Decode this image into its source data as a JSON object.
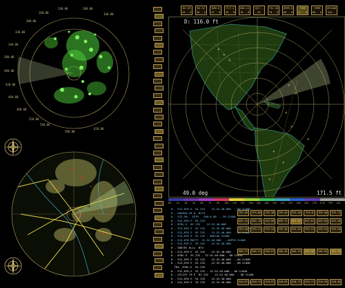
{
  "map_panel": {
    "range_readout": "D: 116.0 ft",
    "bearing_readout": "49.0 deg",
    "distance_readout": "171.5 ft"
  },
  "header_buttons": [
    {
      "top": "NJ-69",
      "bottom": "20 - 5"
    },
    {
      "top": "NJ-32",
      "bottom": "56 - 6"
    },
    {
      "top": "BGN-8",
      "bottom": "15 - 8"
    },
    {
      "top": "FLT-2",
      "bottom": "45 - 8"
    },
    {
      "top": "ENG-11",
      "bottom": "78 - 8"
    },
    {
      "top": "OCC - 81",
      "bottom": "78 - 8"
    },
    {
      "top": "TIL-38",
      "bottom": "78 - 8"
    },
    {
      "top": "OPER-8",
      "bottom": "68 - 8"
    },
    {
      "top": "TERM",
      "bottom": "47 - 8"
    },
    {
      "top": "TERM",
      "bottom": "66 - 8"
    },
    {
      "top": "UPLOAD",
      "bottom": "943 - 8"
    }
  ],
  "color_scale": [
    "NO",
    "15",
    "30",
    "45",
    "60",
    "75",
    "90",
    "105",
    "120",
    "135",
    "150+",
    "165",
    "180",
    "195",
    "210",
    "225",
    "240",
    "255",
    "270",
    "B.B",
    "IFR",
    "10+"
  ],
  "log_top": [
    "6 - E12,876 E  81 232    22.52.46.000  - 86 CLOUD",
    "6 - E04829-76 6  B174",
    "6 - E12.56,  E37R   I4N-0.00  - 39 CLOUD",
    "6 - E12,876 E  81.232",
    "6 - B79L.E  81 232    22.52.46.000",
    "6 - E12,876 E  81 232    22.52.46.000  - 86 CLOUD",
    "6 - E12,876 E  81 232    22.52.46.000  - 86 CLOUD",
    "6 - E12,876 E  91 232 - ADD?OA CLOUD",
    "6 - E12,876 MU777  22.52.46.000  - ADP39 CLOUD",
    "6 - E12,876 E  91 232    22.52.46.000"
  ],
  "log_bottom": [
    "6 - E06787 DLLL  B74",
    "6 - E12,876 E  81 232    22.52.46.000",
    "6 - B78L.E  91 232 - 22.52.46.000 - 98 CLOUD",
    "6 - E12,876 E  91 232    22.52.46.000  - 86 CLOUD",
    "6 - E12,876 E  81 232    22.52.46.000  - 86 CLOUD",
    "  TRA  B78L.E  81.232",
    "6 - E12,876 E  91 232 - 22.52.46.000 - 86 CLOUD",
    "6 - UTLIZY 79 E  81 232    22.52.46.000  - 86 CLOUD",
    "6 - E12,876 E  91 232    22.52.46.000",
    "6 - E12,876 E  91 232    22.52.46.000  - 86 CLOUD"
  ],
  "grid_rows": [
    [
      "TFE-56",
      "TFG-06",
      "TFE-36",
      "TFE-45",
      "TFE-26",
      "TFA-8",
      "TFE-46",
      "TFE-72"
    ],
    [
      "AGS-45",
      "AGS-78",
      "AGS-80",
      "AFE-72",
      "AFE-92",
      "AFE-61",
      "AFE-84",
      "AFE-36"
    ],
    [
      "TFG-48",
      "TFG-71",
      "TFG-24",
      "TFG-36",
      "TFE-32",
      "TFE-15",
      "TFE-91",
      "TFE-54"
    ],
    [
      "SAS-71",
      "SAS-12",
      "SAS-07",
      "SAS-45",
      "SAS-16",
      "SAS-98",
      "SAS-62",
      "SAS-58"
    ],
    [
      "SLN-07",
      "SLN-12",
      "SLN-67",
      "SLN-85",
      "SLN-73",
      "SLN-71",
      "SLN-94",
      "SLN-46"
    ]
  ]
}
